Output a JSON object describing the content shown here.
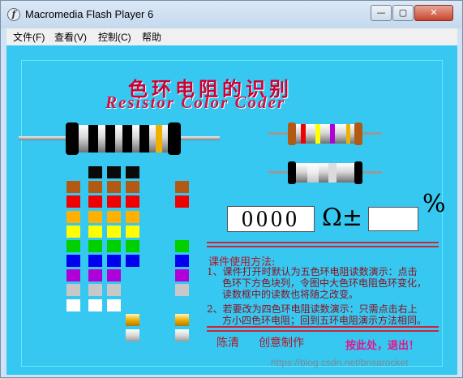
{
  "window": {
    "title": "Macromedia Flash Player 6",
    "app_icon_glyph": "f",
    "controls": {
      "minimize": "—",
      "restore": "▢",
      "close": "✕"
    }
  },
  "menu": [
    {
      "label": "文件(F)"
    },
    {
      "label": "查看(V)"
    },
    {
      "label": "控制(C)"
    },
    {
      "label": "帮助"
    }
  ],
  "app": {
    "title_cn": "色环电阻的识别",
    "title_en": "Resistor Color Coder",
    "resistance_readout": "0000",
    "ohm_symbol": "Ω±",
    "percent_symbol": "%",
    "tolerance_value": ""
  },
  "colors": {
    "stage_bg": "#36c8f0",
    "black": "#0a0a0a",
    "brown": "#b25a14",
    "red": "#f00000",
    "orange": "#ff9a00",
    "yellow": "#ffff00",
    "green": "#00d000",
    "blue": "#0000ee",
    "violet": "#b000d8",
    "gray": "#c8c8c8",
    "white": "#ffffff",
    "gold": "#f0b000",
    "silver": "#e0e0e0"
  },
  "instructions": {
    "heading": "课件使用方法:",
    "lines": [
      "1、课件打开时默认为五色环电阻读数演示：点击",
      "色环下方色块列，令图中大色环电阻色环变化，",
      "读数框中的读数也将随之改变。",
      "2、若要改为四色环电阻读数演示：只需点击右上",
      "方小四色环电阻；回到五环电阻演示方法相同。"
    ]
  },
  "credits": {
    "author": "陈清",
    "made_by": "创意制作"
  },
  "exit_label": "按此处，退出！",
  "watermark": "https://blog.csdn.net/bnsarocket"
}
